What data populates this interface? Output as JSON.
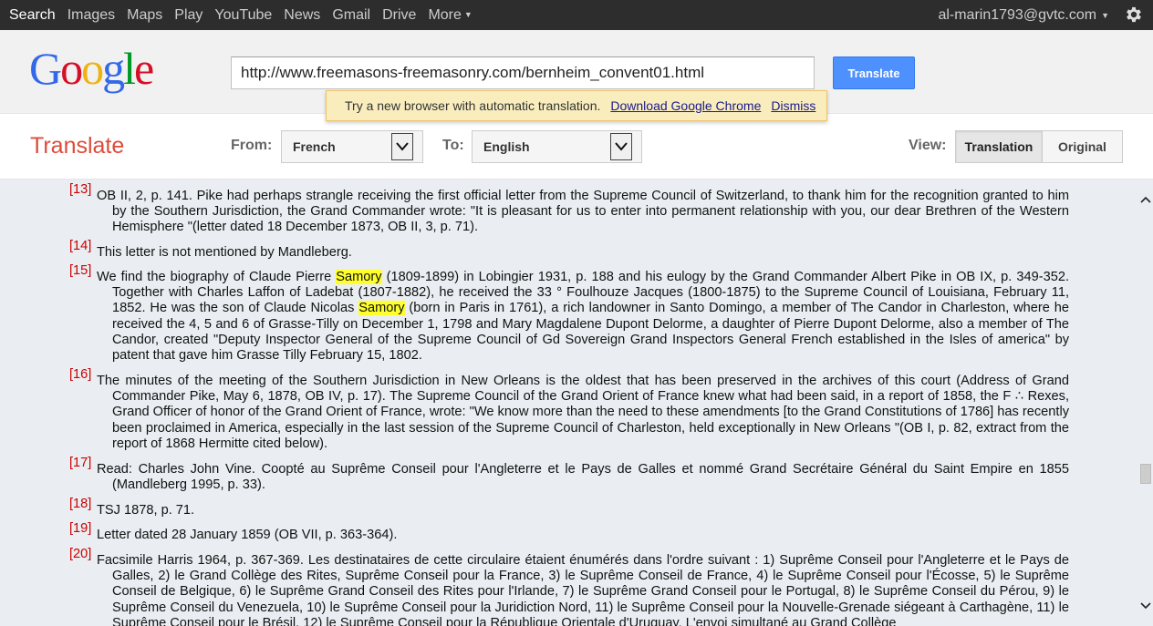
{
  "gbar": {
    "links": [
      "Search",
      "Images",
      "Maps",
      "Play",
      "YouTube",
      "News",
      "Gmail",
      "Drive"
    ],
    "more": "More",
    "account": "al-marin1793@gvtc.com"
  },
  "header": {
    "logo": {
      "g1": "G",
      "o1": "o",
      "o2": "o",
      "g2": "g",
      "l": "l",
      "e": "e"
    },
    "url": "http://www.freemasons-freemasonry.com/bernheim_convent01.html",
    "translate_button": "Translate"
  },
  "notice": {
    "text": "Try a new browser with automatic translation.",
    "download_link": "Download Google Chrome",
    "dismiss_link": "Dismiss"
  },
  "tbar": {
    "title": "Translate",
    "from_label": "From:",
    "from_value": "French",
    "to_label": "To:",
    "to_value": "English",
    "view_label": "View:",
    "view_translation": "Translation",
    "view_original": "Original"
  },
  "notes": [
    {
      "num": "[13]",
      "parts": [
        {
          "t": "OB II, 2, p. 141. Pike had perhaps strangle receiving the first official letter from the Supreme Council of Switzerland, to thank him for the recognition granted to him by the Southern Jurisdiction, the Grand Commander wrote: \"It is pleasant for us to enter into permanent relationship with you, our dear Brethren of the Western Hemisphere \"(letter dated 18 December 1873, OB II, 3, p. 71)."
        }
      ]
    },
    {
      "num": "[14]",
      "parts": [
        {
          "t": "This letter is not mentioned by Mandleberg."
        }
      ]
    },
    {
      "num": "[15]",
      "parts": [
        {
          "t": "We find the biography of Claude Pierre "
        },
        {
          "t": "Samory",
          "h": true
        },
        {
          "t": " (1809-1899) in Lobingier 1931, p. 188 and his eulogy by the Grand Commander Albert Pike in OB IX, p. 349-352. Together with Charles Laffon of Ladebat (1807-1882), he received the 33 ° Foulhouze Jacques (1800-1875) to the Supreme Council of Louisiana, February 11, 1852. He was the son of Claude Nicolas "
        },
        {
          "t": "Samory",
          "h": true
        },
        {
          "t": " (born in Paris in 1761), a rich landowner in Santo Domingo, a member of The Candor in Charleston, where he received the 4, 5 and 6 of Grasse-Tilly on December 1, 1798 and Mary Magdalene Dupont Delorme, a daughter of Pierre Dupont Delorme, also a member of The Candor, created \"Deputy Inspector General of the Supreme Council of Gd Sovereign Grand Inspectors General French established in the Isles of america\" by patent that gave him Grasse Tilly February 15, 1802."
        }
      ]
    },
    {
      "num": "[16]",
      "parts": [
        {
          "t": "The minutes of the meeting of the Southern Jurisdiction in New Orleans is the oldest that has been preserved in the archives of this court (Address of Grand Commander Pike, May 6, 1878, OB IV, p. 17). The Supreme Council of the Grand Orient of France knew what had been said, in a report of 1858, the F ∴ Rexes, Grand Officer of honor of the Grand Orient of France, wrote: \"We know more than the need to these amendments [to the Grand Constitutions of 1786] has recently been proclaimed in America, especially in the last session of the Supreme Council of Charleston, held exceptionally in New Orleans \"(OB I, p. 82, extract from the report of 1868 Hermitte cited below)."
        }
      ]
    },
    {
      "num": "[17]",
      "parts": [
        {
          "t": "Read: Charles John Vine. Coopté au Suprême Conseil pour l'Angleterre et le Pays de Galles et nommé Grand Secrétaire Général du Saint Empire en 1855 (Mandleberg 1995, p. 33)."
        }
      ]
    },
    {
      "num": "[18]",
      "parts": [
        {
          "t": "TSJ 1878, p. 71."
        }
      ]
    },
    {
      "num": "[19]",
      "parts": [
        {
          "t": "Letter dated 28 January 1859 (OB VII, p. 363-364)."
        }
      ]
    },
    {
      "num": "[20]",
      "parts": [
        {
          "t": "Facsimile Harris 1964, p. 367-369. Les destinataires de cette circulaire étaient énumérés dans l'ordre suivant : 1) Suprême Conseil pour l'Angleterre et le Pays de Galles, 2) le Grand Collège des Rites, Suprême Conseil pour la France, 3) le Suprême Conseil de France, 4) le Suprême Conseil pour l'Écosse, 5) le Suprême Conseil de Belgique, 6) le Suprême Grand Conseil des Rites pour l'Irlande, 7) le Suprême Grand Conseil pour le Portugal, 8) le Suprême Conseil du Pérou, 9) le Suprême Conseil du Venezuela, 10) le Suprême Conseil pour la Juridiction Nord, 11) le Suprême Conseil pour la Nouvelle-Grenade siégeant à Carthagène, 11) le Suprême Conseil pour le Brésil, 12) le Suprême Conseil pour la République Orientale d'Uruguay. L'envoi simultané au Grand Collège"
        }
      ]
    }
  ]
}
